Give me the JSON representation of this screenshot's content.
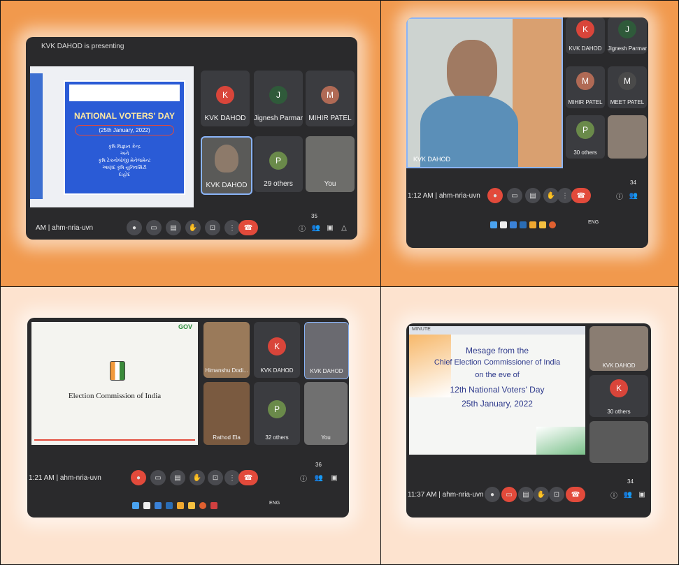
{
  "colors": {
    "orange": "#f1994d",
    "peach": "#fde3cf",
    "meet_red": "#e24a3b",
    "slide_blue": "#2a5bd6"
  },
  "panel1": {
    "presenting_banner": "KVK DAHOD is presenting",
    "slide": {
      "title": "NATIONAL VOTERS' DAY",
      "date": "(25th January, 2022)",
      "line1": "કૃષિ વિજ્ઞાન કેન્દ્ર",
      "line2": "અને",
      "line3": "કૃષિ ટેકનોલોજી મેનેજમેન્ટ",
      "line4": "આણંદ કૃષિ યુનિવર્સિટી",
      "line5": "દાહોદ"
    },
    "tiles": [
      {
        "initial": "K",
        "name": "KVK DAHOD"
      },
      {
        "initial": "J",
        "name": "Jignesh Parmar"
      },
      {
        "initial": "M",
        "name": "MIHIR PATEL"
      },
      {
        "name": "KVK DAHOD"
      },
      {
        "initial": "P",
        "name": "29 others"
      },
      {
        "name": "You"
      }
    ],
    "meeting_code": "AM | ahm-nria-uvn",
    "count": "35"
  },
  "panel2": {
    "speaker_name": "KVK DAHOD",
    "tiles": [
      {
        "initial": "K",
        "name": "KVK DAHOD"
      },
      {
        "initial": "J",
        "name": "Jignesh Parmar"
      },
      {
        "initial": "M",
        "name": "MIHIR PATEL"
      },
      {
        "initial": "M",
        "name": "MEET PATEL"
      },
      {
        "initial": "P",
        "name": "30 others"
      }
    ],
    "meeting_code": "1:12 AM | ahm-nria-uvn",
    "count": "34",
    "lang": "ENG"
  },
  "panel3": {
    "logo_text": "GOV",
    "eci_text": "Election Commission of India",
    "tiles": [
      {
        "name": "Himanshu Dodi..."
      },
      {
        "initial": "K",
        "name": "KVK DAHOD"
      },
      {
        "name": "KVK DAHOD"
      },
      {
        "name": "Rathod Ela"
      },
      {
        "initial": "P",
        "name": "32 others"
      },
      {
        "name": "You"
      }
    ],
    "meeting_code": "1:21 AM | ahm-nria-uvn",
    "count": "36",
    "lang": "ENG"
  },
  "panel4": {
    "top_label": "MINUTE",
    "message_lines": [
      "Mesage from the",
      "Chief Election Commissioner of India",
      "on the eve of",
      "12th National Voters' Day",
      "25th January, 2022"
    ],
    "tiles": [
      {
        "name": "KVK DAHOD"
      },
      {
        "initial": "K",
        "name": "30 others"
      },
      {
        "name": ""
      }
    ],
    "meeting_code": "11:37 AM | ahm-nria-uvn",
    "count": "34"
  }
}
